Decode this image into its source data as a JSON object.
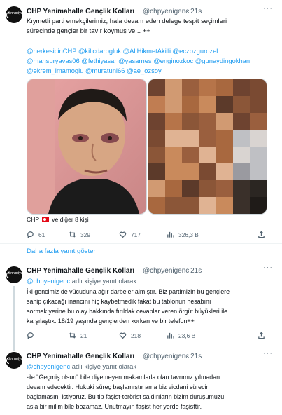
{
  "colors": {
    "link": "#1d9bf0",
    "muted": "#536471",
    "divider": "#eff3f4"
  },
  "tweet1": {
    "name": "CHP Yenimahalle Gençlik Kolları",
    "handle": "@chpyenigenc",
    "time": "· 21s",
    "text_line1": "Kıymetli parti emekçilerimiz, hala devam eden delege tespit seçimleri",
    "text_line2": "sürecinde gençler bir tavır koymuş ve... ++",
    "tags_line1": "@herkesicinCHP @kilicdarogluk @AliHikmetAkilli @eczozgurozel",
    "tags_line2": "@mansuryavas06 @fethiyasar @yasarnes @enginozkoc @gunaydingokhan",
    "tags_line3": "@ekrem_imamoglu @muratunl66 @ae_ozsoy",
    "tagged_prefix": "CHP",
    "tagged_suffix": "ve diğer 8 kişi",
    "replies": "61",
    "retweets": "329",
    "likes": "717",
    "views": "326,3 B"
  },
  "show_more": "Daha fazla yanıt göster",
  "tweet2": {
    "name": "CHP Yenimahalle Gençlik Kolları",
    "handle": "@chpyenigenc",
    "time": "· 21s",
    "reply_handle": "@chpyenigenc",
    "reply_suffix": "adlı kişiye yanıt olarak",
    "line1": "İki gencimiz de vücuduna ağır darbeler almıştır. Biz partimizin bu gençlere",
    "line2": "sahip çıkacağı inancını hiç kaybetmedik fakat bu tablonun hesabını",
    "line3": "sormak yerine bu olay hakkında fırıldak cevaplar veren örgüt büyükleri ile",
    "line4": "karşılaştık. 18/19 yaşında gençlerden korkan ve bir telefon++",
    "replies": "",
    "retweets": "21",
    "likes": "218",
    "views": "23,6 B"
  },
  "tweet3": {
    "name": "CHP Yenimahalle Gençlik Kolları",
    "handle": "@chpyenigenc",
    "time": "· 21s",
    "reply_handle": "@chpyenigenc",
    "reply_suffix": "adlı kişiye yanıt olarak",
    "line1": "-ile \"Geçmiş olsun\" bile diyemeyen makamlarla olan tavrımız yılmadan",
    "line2": "devam edecektir. Hukuki süreç başlamıştır ama biz vicdani sürecin",
    "line3": "başlamasını istiyoruz. Bu tip faşist-terörist saldırıların bizim duruşumuzu",
    "line4": "asla bir milim bile bozamaz. Unutmayın faşist her yerde faşisttir."
  },
  "icons": [
    "reply-icon",
    "retweet-icon",
    "like-icon",
    "views-icon",
    "share-icon",
    "more-icon",
    "flag-icon"
  ]
}
